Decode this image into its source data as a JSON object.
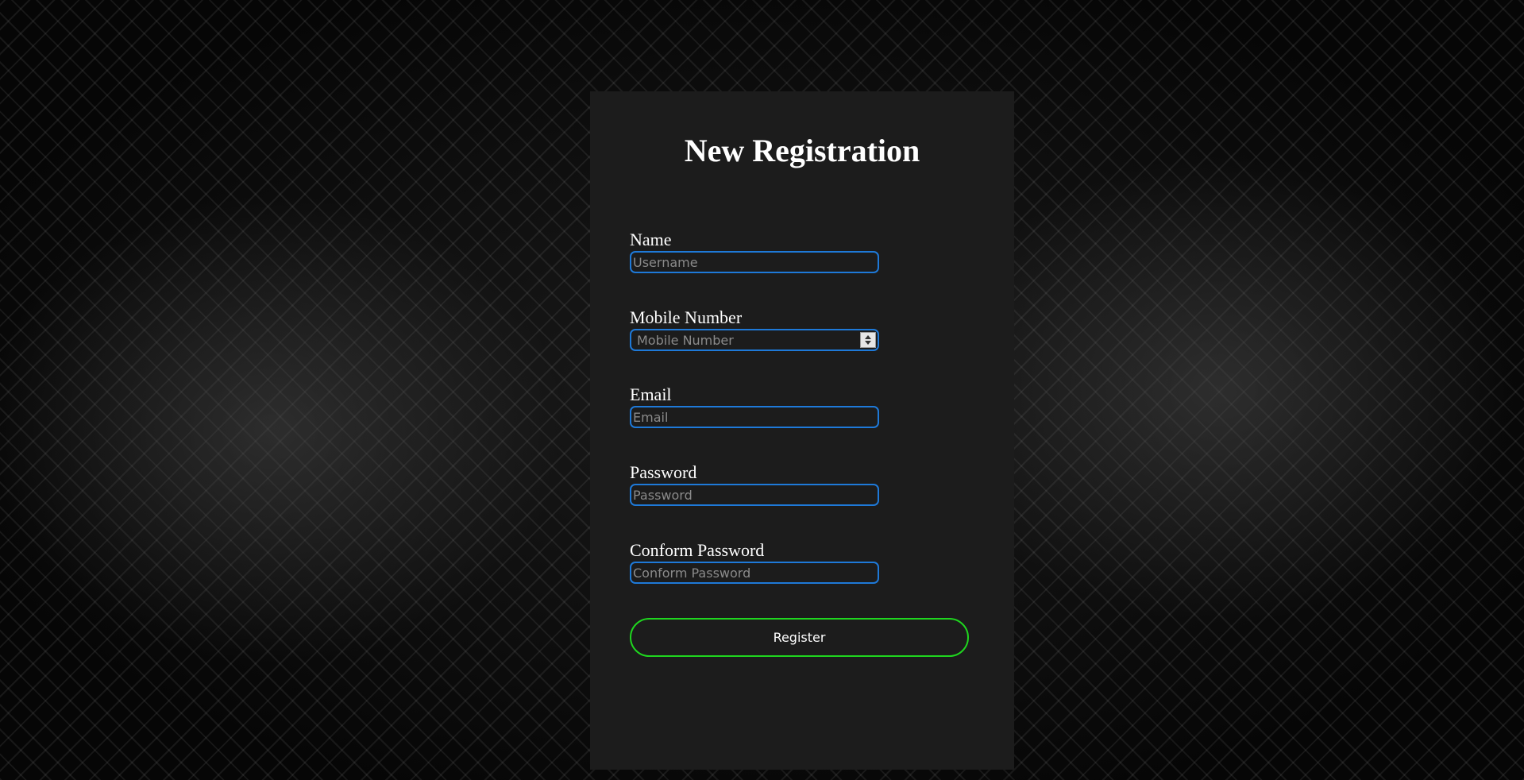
{
  "form": {
    "title": "New Registration",
    "fields": [
      {
        "label": "Name",
        "placeholder": "Username",
        "type": "text"
      },
      {
        "label": "Mobile Number",
        "placeholder": "Mobile Number",
        "type": "number"
      },
      {
        "label": "Email",
        "placeholder": "Email",
        "type": "email"
      },
      {
        "label": "Password",
        "placeholder": "Password",
        "type": "password"
      },
      {
        "label": "Conform Password",
        "placeholder": "Conform Password",
        "type": "password"
      }
    ],
    "submit_label": "Register"
  },
  "colors": {
    "background": "#050505",
    "card": "#1c1c1c",
    "input_border": "#1e79d8",
    "button_border": "#1fd61f",
    "text": "#ffffff",
    "placeholder": "#8a8a8a"
  },
  "icons": {
    "number_spinner": "spinner-arrows-icon"
  }
}
